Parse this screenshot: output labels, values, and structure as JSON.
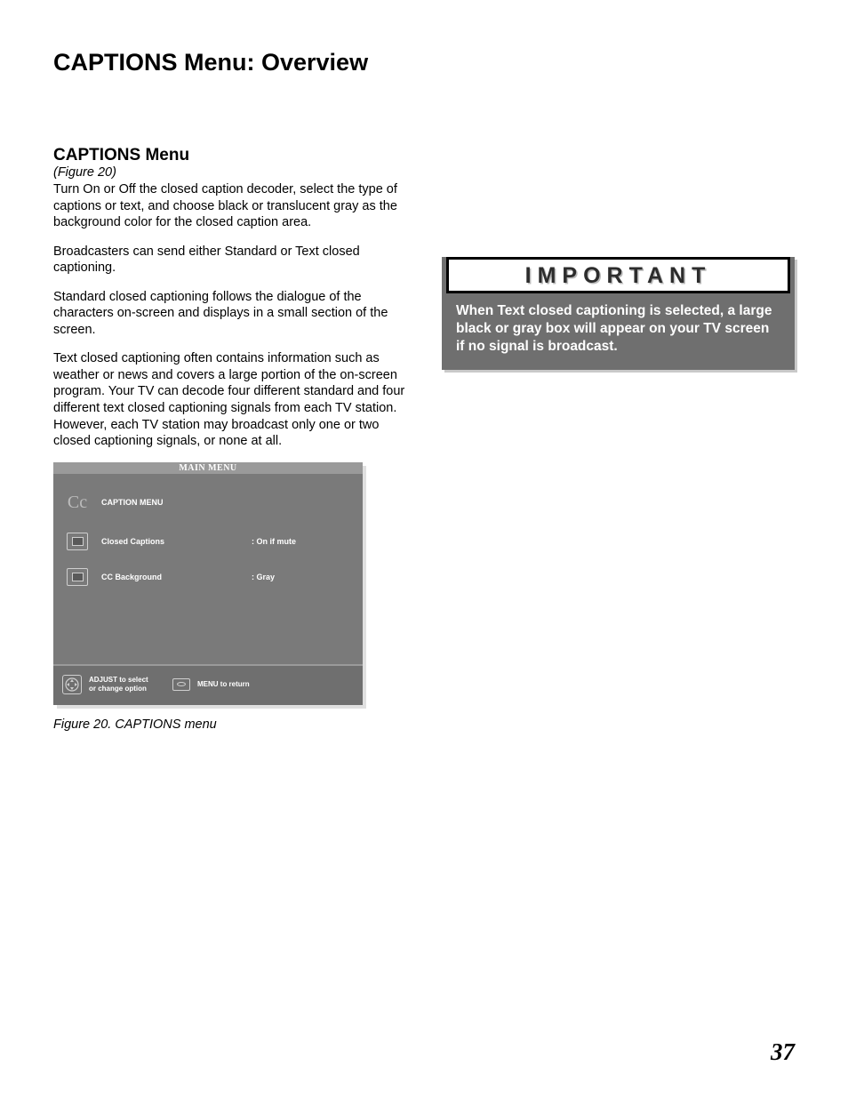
{
  "page_title": "CAPTIONS Menu: Overview",
  "section": {
    "heading": "CAPTIONS Menu",
    "fig_ref": "(Figure 20)",
    "p1": "Turn On or Off the closed caption decoder, select the type of captions or text, and choose black or translucent gray as the background color for the closed caption area.",
    "p2": "Broadcasters can send either Standard or Text closed captioning.",
    "p3": "Standard closed captioning follows the dialogue of the characters on-screen and displays in a small section of the screen.",
    "p4": "Text closed captioning often contains information such as weather or news and covers a large portion of the on-screen program.  Your TV can decode four different standard and four different text closed captioning signals from each TV station.  However, each TV station may broadcast only one or two closed captioning signals, or none at all."
  },
  "osd": {
    "titlebar": "MAIN MENU",
    "menu_title": "CAPTION MENU",
    "cc_glyph": "Cc",
    "rows": [
      {
        "label": "Closed Captions",
        "value": ":  On if mute"
      },
      {
        "label": "CC Background",
        "value": ":  Gray"
      }
    ],
    "footer": {
      "adjust_line1": "ADJUST to select",
      "adjust_line2": "or  change option",
      "menu_return": "MENU  to  return"
    }
  },
  "fig_caption": "Figure 20.  CAPTIONS menu",
  "important": {
    "header": "IMPORTANT",
    "body": "When Text closed captioning is selected, a large black or gray box will appear on your TV screen if no signal is broadcast."
  },
  "page_number": "37"
}
